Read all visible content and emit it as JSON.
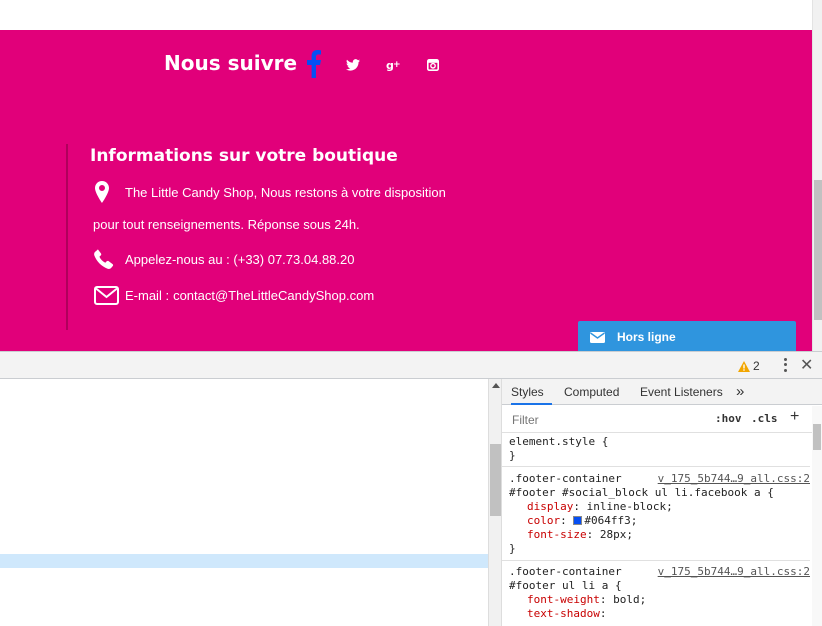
{
  "footer": {
    "follow_title": "Nous suivre",
    "social_icons": [
      "facebook-icon",
      "twitter-icon",
      "google-plus-icon",
      "instagram-icon"
    ],
    "facebook_color": "#064ff3",
    "bg_color": "#e1007a",
    "info_title": "Informations sur votre boutique",
    "address_line1": "The Little Candy Shop, Nous restons à votre disposition",
    "address_line2": "pour tout renseignements. Réponse sous 24h.",
    "phone": "Appelez-nous au : (+33) 07.73.04.88.20",
    "email_label": "E-mail :",
    "email": "contact@TheLittleCandyShop.com"
  },
  "chat": {
    "label": "Hors ligne",
    "color": "#2f95de"
  },
  "devtools": {
    "warning_count": "2",
    "tabs": [
      "Styles",
      "Computed",
      "Event Listeners",
      "»"
    ],
    "active_tab": "Styles",
    "filter_placeholder": "Filter",
    "hov": ":hov",
    "cls": ".cls",
    "plus": "+",
    "rules": [
      {
        "lines": [
          "element.style {",
          "}"
        ]
      },
      {
        "selector1": ".footer-container",
        "source": "v_175_5b744…9_all.css:2",
        "selector2": "#footer #social_block ul li.facebook a {",
        "props": [
          {
            "name": "display",
            "value": "inline-block;"
          },
          {
            "name": "color",
            "value": "#064ff3;"
          },
          {
            "name": "font-size",
            "value": "28px;"
          }
        ],
        "close": "}"
      },
      {
        "selector1": ".footer-container",
        "source": "v_175_5b744…9_all.css:2",
        "selector2": "#footer ul li a {",
        "props": [
          {
            "name": "font-weight",
            "value": "bold;"
          },
          {
            "name": "text-shadow",
            "value": ""
          }
        ]
      }
    ]
  }
}
